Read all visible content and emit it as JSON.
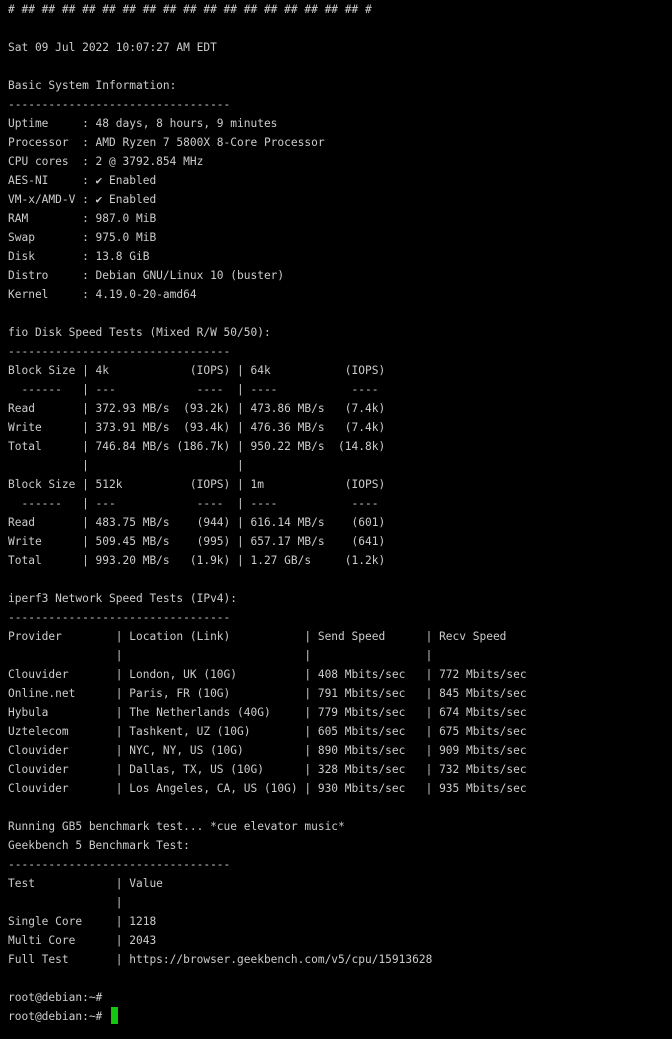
{
  "terminal": {
    "lines": [
      "# ## ## ## ## ## ## ## ## ## ## ## ## ## ## ## ## ## #",
      "",
      "Sat 09 Jul 2022 10:07:27 AM EDT",
      "",
      "Basic System Information:",
      "---------------------------------",
      "Uptime     : 48 days, 8 hours, 9 minutes",
      "Processor  : AMD Ryzen 7 5800X 8-Core Processor",
      "CPU cores  : 2 @ 3792.854 MHz",
      "AES-NI     : ✔ Enabled",
      "VM-x/AMD-V : ✔ Enabled",
      "RAM        : 987.0 MiB",
      "Swap       : 975.0 MiB",
      "Disk       : 13.8 GiB",
      "Distro     : Debian GNU/Linux 10 (buster)",
      "Kernel     : 4.19.0-20-amd64",
      "",
      "fio Disk Speed Tests (Mixed R/W 50/50):",
      "---------------------------------",
      "Block Size | 4k            (IOPS) | 64k           (IOPS)",
      "  ------   | ---            ----  | ----           ----",
      "Read       | 372.93 MB/s  (93.2k) | 473.86 MB/s   (7.4k)",
      "Write      | 373.91 MB/s  (93.4k) | 476.36 MB/s   (7.4k)",
      "Total      | 746.84 MB/s (186.7k) | 950.22 MB/s  (14.8k)",
      "           |                      |",
      "Block Size | 512k          (IOPS) | 1m            (IOPS)",
      "  ------   | ---            ----  | ----           ----",
      "Read       | 483.75 MB/s    (944) | 616.14 MB/s    (601)",
      "Write      | 509.45 MB/s    (995) | 657.17 MB/s    (641)",
      "Total      | 993.20 MB/s   (1.9k) | 1.27 GB/s     (1.2k)",
      "",
      "iperf3 Network Speed Tests (IPv4):",
      "---------------------------------",
      "Provider        | Location (Link)           | Send Speed      | Recv Speed",
      "                |                           |                 |",
      "Clouvider       | London, UK (10G)          | 408 Mbits/sec   | 772 Mbits/sec",
      "Online.net      | Paris, FR (10G)           | 791 Mbits/sec   | 845 Mbits/sec",
      "Hybula          | The Netherlands (40G)     | 779 Mbits/sec   | 674 Mbits/sec",
      "Uztelecom       | Tashkent, UZ (10G)        | 605 Mbits/sec   | 675 Mbits/sec",
      "Clouvider       | NYC, NY, US (10G)         | 890 Mbits/sec   | 909 Mbits/sec",
      "Clouvider       | Dallas, TX, US (10G)      | 328 Mbits/sec   | 732 Mbits/sec",
      "Clouvider       | Los Angeles, CA, US (10G) | 930 Mbits/sec   | 935 Mbits/sec",
      "",
      "Running GB5 benchmark test... *cue elevator music*",
      "Geekbench 5 Benchmark Test:",
      "---------------------------------",
      "Test            | Value",
      "                |",
      "Single Core     | 1218",
      "Multi Core      | 2043",
      "Full Test       | https://browser.geekbench.com/v5/cpu/15913628",
      "",
      "root@debian:~#",
      "root@debian:~# "
    ],
    "cursor_color": "#16c60c",
    "text_color": "#cccccc",
    "background_color": "#000000"
  }
}
